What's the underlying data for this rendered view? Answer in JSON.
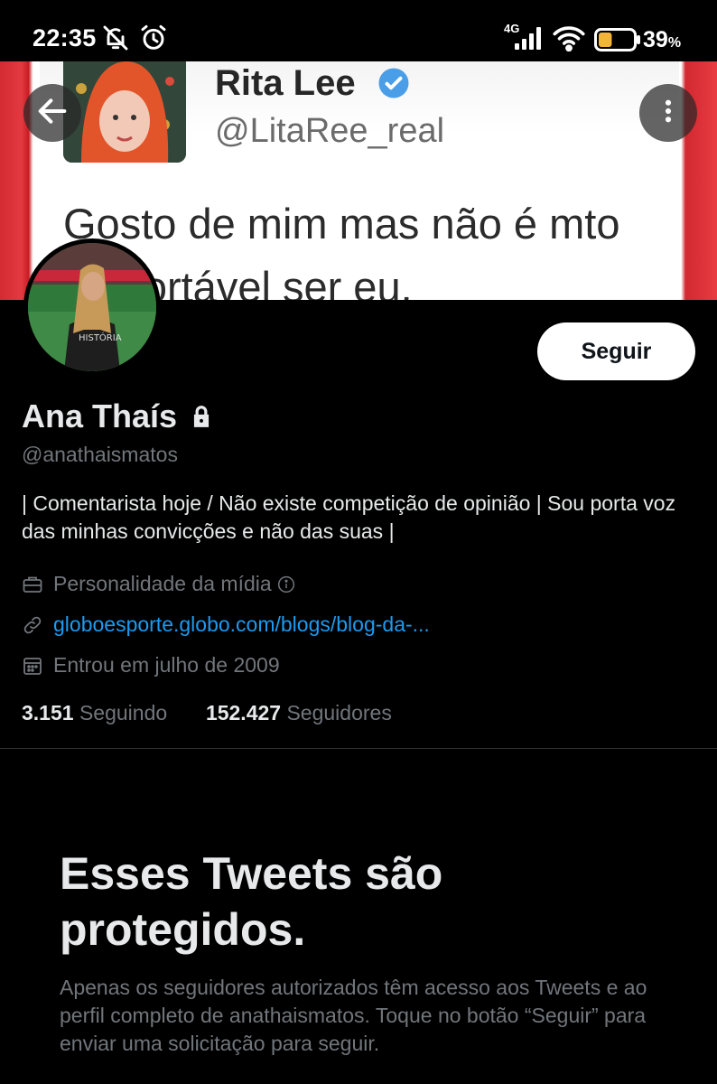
{
  "status_bar": {
    "time": "22:35",
    "network": "4G",
    "battery_percent": "39",
    "battery_level": 0.39,
    "icons": [
      "notifications-muted-icon",
      "alarm-icon",
      "signal-icon",
      "wifi-icon",
      "battery-icon"
    ]
  },
  "banner": {
    "quoted_name": "Rita Lee",
    "quoted_handle": "@LitaRee_real",
    "quote_line1": "Gosto de mim mas não é mto",
    "quote_line2": "confortável ser eu."
  },
  "toolbar": {
    "back_icon": "arrow-left-icon",
    "more_icon": "more-vertical-icon"
  },
  "profile": {
    "follow_label": "Seguir",
    "display_name": "Ana Thaís",
    "handle": "@anathaismatos",
    "bio": "| Comentarista hoje / Não existe competição de opinião | Sou porta voz das minhas convicções e não das suas |",
    "category": "Personalidade da mídia",
    "link": "globoesporte.globo.com/blogs/blog-da-...",
    "joined": "Entrou em julho de 2009",
    "following_count": "3.151",
    "following_label": "Seguindo",
    "followers_count": "152.427",
    "followers_label": "Seguidores"
  },
  "protected": {
    "title": "Esses Tweets são protegidos.",
    "text": "Apenas os seguidores autorizados têm acesso aos Tweets e ao perfil completo de anathaismatos. Toque no botão “Seguir” para enviar uma solicitação para seguir."
  },
  "colors": {
    "background": "#000000",
    "link": "#1d9bf0",
    "muted_text": "#71767b",
    "primary_text": "#e7e9ea"
  }
}
